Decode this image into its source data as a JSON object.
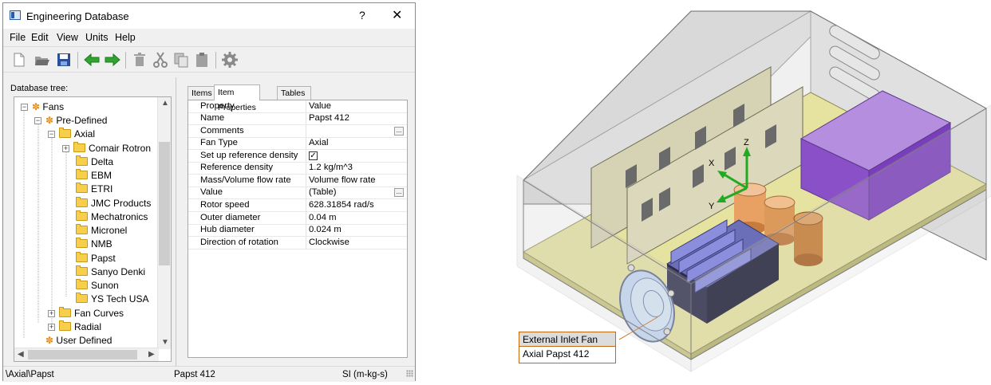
{
  "window": {
    "title": "Engineering Database",
    "help": "?",
    "close": "✕"
  },
  "menu": [
    "File",
    "Edit",
    "View",
    "Units",
    "Help"
  ],
  "toolbar": {
    "icons": [
      "new-icon",
      "open-icon",
      "save-icon",
      "back-icon",
      "forward-icon",
      "delete-icon",
      "cut-icon",
      "copy-icon",
      "paste-icon",
      "settings-icon"
    ]
  },
  "tree": {
    "label": "Database tree:",
    "items": [
      {
        "label": "Fans"
      },
      {
        "label": "Pre-Defined"
      },
      {
        "label": "Axial"
      },
      {
        "label": "Comair Rotron"
      },
      {
        "label": "Delta"
      },
      {
        "label": "EBM"
      },
      {
        "label": "ETRI"
      },
      {
        "label": "JMC Products"
      },
      {
        "label": "Mechatronics"
      },
      {
        "label": "Micronel"
      },
      {
        "label": "NMB"
      },
      {
        "label": "Papst"
      },
      {
        "label": "Sanyo Denki"
      },
      {
        "label": "Sunon"
      },
      {
        "label": "YS Tech USA"
      },
      {
        "label": "Fan Curves"
      },
      {
        "label": "Radial"
      },
      {
        "label": "User Defined"
      }
    ]
  },
  "tabs": [
    "Items",
    "Item Properties",
    "Tables and Curves"
  ],
  "properties": {
    "header": {
      "property": "Property",
      "value": "Value"
    },
    "rows": [
      {
        "property": "Name",
        "value": "Papst 412"
      },
      {
        "property": "Comments",
        "value": ""
      },
      {
        "property": "Fan Type",
        "value": "Axial"
      },
      {
        "property": "Set up reference density",
        "value": "✓"
      },
      {
        "property": "Reference density",
        "value": "1.2 kg/m^3"
      },
      {
        "property": "Mass/Volume flow rate",
        "value": "Volume flow rate"
      },
      {
        "property": "Value",
        "value": "(Table)"
      },
      {
        "property": "Rotor speed",
        "value": "628.31854 rad/s"
      },
      {
        "property": "Outer diameter",
        "value": "0.04 m"
      },
      {
        "property": "Hub diameter",
        "value": "0.024 m"
      },
      {
        "property": "Direction of rotation",
        "value": "Clockwise"
      }
    ],
    "ellipsis": "..."
  },
  "status": {
    "path": "\\Axial\\Papst",
    "item": "Papst 412",
    "units": "SI (m-kg-s)"
  },
  "scene": {
    "axes": {
      "x": "X",
      "y": "Y",
      "z": "Z"
    },
    "callout": {
      "title": "External Inlet Fan",
      "subtitle": "Axial Papst 412"
    }
  }
}
